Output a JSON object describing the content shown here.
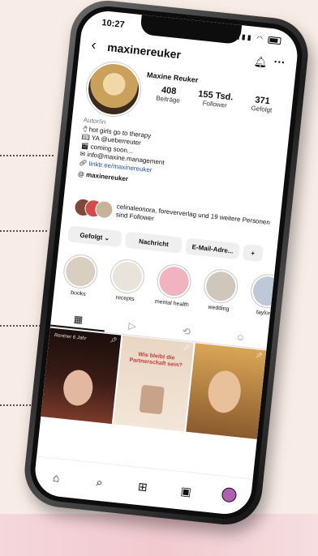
{
  "status": {
    "time": "10:27"
  },
  "profile": {
    "username": "maxinereuker",
    "display_name": "Maxine Reuker",
    "stats": [
      {
        "value": "408",
        "label": "Beiträge"
      },
      {
        "value": "155 Tsd.",
        "label": "Follower"
      },
      {
        "value": "371",
        "label": "Gefolgt"
      }
    ],
    "bio": {
      "label": "Autor/in",
      "lines": [
        "hot girls go to therapy",
        "YA @ueberreuter",
        "coming soon...",
        "info@maxine.management"
      ],
      "link": "linktr.ee/maxinereuker",
      "threads": "maxinereuker"
    },
    "followed_by": "celinaleonora, foreververlag und 19 weitere Personen sind Follower"
  },
  "actions": {
    "follow": "Gefolgt ⌄",
    "message": "Nachricht",
    "email": "E-Mail-Adre...",
    "add_person": "+"
  },
  "highlights": [
    {
      "label": "books",
      "color": "#d9cfc0"
    },
    {
      "label": "recepts",
      "color": "#e8e4dc"
    },
    {
      "label": "mental health",
      "color": "#f0b3bf"
    },
    {
      "label": "wedding",
      "color": "#cfc7bc"
    },
    {
      "label": "taylor s",
      "color": "#bfc8d6"
    }
  ],
  "posts": [
    {
      "caption": "Rentner 6 Jahr"
    },
    {
      "caption": "Wie bleibt die Partnerschaft sein?"
    },
    {
      "caption": ""
    }
  ],
  "icons": {
    "back": "back-icon",
    "bell": "bell-icon",
    "more": "more-icon",
    "link": "link-icon",
    "threads": "threads-icon",
    "home": "home-icon",
    "search": "search-icon",
    "add": "add-icon",
    "reels": "reels-icon",
    "profile": "profile-icon"
  }
}
